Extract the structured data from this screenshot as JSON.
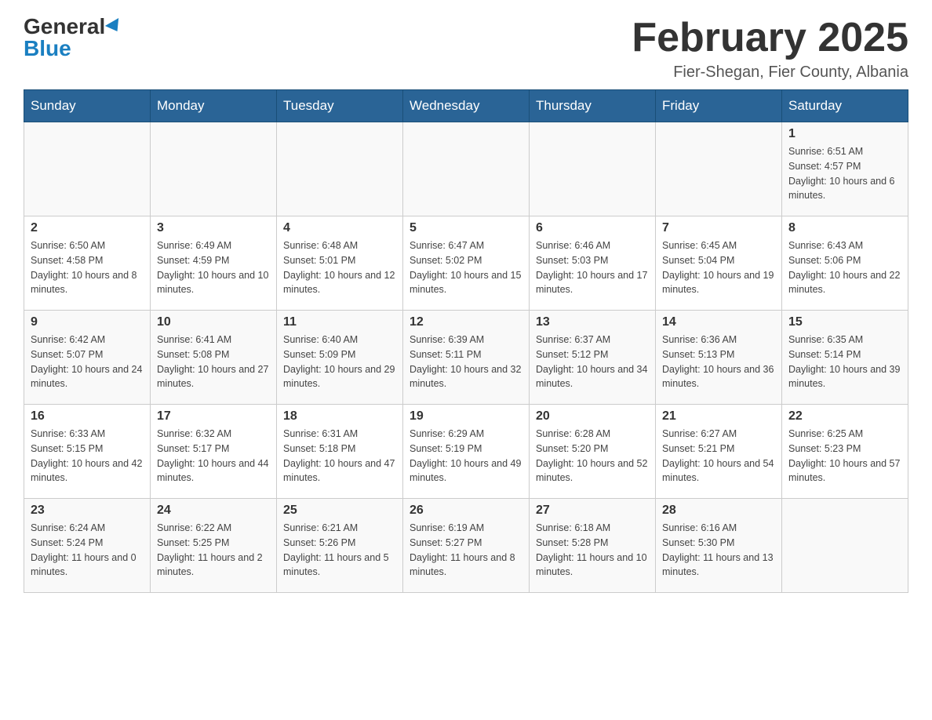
{
  "logo": {
    "general": "General",
    "blue": "Blue"
  },
  "title": "February 2025",
  "subtitle": "Fier-Shegan, Fier County, Albania",
  "days_of_week": [
    "Sunday",
    "Monday",
    "Tuesday",
    "Wednesday",
    "Thursday",
    "Friday",
    "Saturday"
  ],
  "weeks": [
    [
      {
        "day": "",
        "info": ""
      },
      {
        "day": "",
        "info": ""
      },
      {
        "day": "",
        "info": ""
      },
      {
        "day": "",
        "info": ""
      },
      {
        "day": "",
        "info": ""
      },
      {
        "day": "",
        "info": ""
      },
      {
        "day": "1",
        "info": "Sunrise: 6:51 AM\nSunset: 4:57 PM\nDaylight: 10 hours and 6 minutes."
      }
    ],
    [
      {
        "day": "2",
        "info": "Sunrise: 6:50 AM\nSunset: 4:58 PM\nDaylight: 10 hours and 8 minutes."
      },
      {
        "day": "3",
        "info": "Sunrise: 6:49 AM\nSunset: 4:59 PM\nDaylight: 10 hours and 10 minutes."
      },
      {
        "day": "4",
        "info": "Sunrise: 6:48 AM\nSunset: 5:01 PM\nDaylight: 10 hours and 12 minutes."
      },
      {
        "day": "5",
        "info": "Sunrise: 6:47 AM\nSunset: 5:02 PM\nDaylight: 10 hours and 15 minutes."
      },
      {
        "day": "6",
        "info": "Sunrise: 6:46 AM\nSunset: 5:03 PM\nDaylight: 10 hours and 17 minutes."
      },
      {
        "day": "7",
        "info": "Sunrise: 6:45 AM\nSunset: 5:04 PM\nDaylight: 10 hours and 19 minutes."
      },
      {
        "day": "8",
        "info": "Sunrise: 6:43 AM\nSunset: 5:06 PM\nDaylight: 10 hours and 22 minutes."
      }
    ],
    [
      {
        "day": "9",
        "info": "Sunrise: 6:42 AM\nSunset: 5:07 PM\nDaylight: 10 hours and 24 minutes."
      },
      {
        "day": "10",
        "info": "Sunrise: 6:41 AM\nSunset: 5:08 PM\nDaylight: 10 hours and 27 minutes."
      },
      {
        "day": "11",
        "info": "Sunrise: 6:40 AM\nSunset: 5:09 PM\nDaylight: 10 hours and 29 minutes."
      },
      {
        "day": "12",
        "info": "Sunrise: 6:39 AM\nSunset: 5:11 PM\nDaylight: 10 hours and 32 minutes."
      },
      {
        "day": "13",
        "info": "Sunrise: 6:37 AM\nSunset: 5:12 PM\nDaylight: 10 hours and 34 minutes."
      },
      {
        "day": "14",
        "info": "Sunrise: 6:36 AM\nSunset: 5:13 PM\nDaylight: 10 hours and 36 minutes."
      },
      {
        "day": "15",
        "info": "Sunrise: 6:35 AM\nSunset: 5:14 PM\nDaylight: 10 hours and 39 minutes."
      }
    ],
    [
      {
        "day": "16",
        "info": "Sunrise: 6:33 AM\nSunset: 5:15 PM\nDaylight: 10 hours and 42 minutes."
      },
      {
        "day": "17",
        "info": "Sunrise: 6:32 AM\nSunset: 5:17 PM\nDaylight: 10 hours and 44 minutes."
      },
      {
        "day": "18",
        "info": "Sunrise: 6:31 AM\nSunset: 5:18 PM\nDaylight: 10 hours and 47 minutes."
      },
      {
        "day": "19",
        "info": "Sunrise: 6:29 AM\nSunset: 5:19 PM\nDaylight: 10 hours and 49 minutes."
      },
      {
        "day": "20",
        "info": "Sunrise: 6:28 AM\nSunset: 5:20 PM\nDaylight: 10 hours and 52 minutes."
      },
      {
        "day": "21",
        "info": "Sunrise: 6:27 AM\nSunset: 5:21 PM\nDaylight: 10 hours and 54 minutes."
      },
      {
        "day": "22",
        "info": "Sunrise: 6:25 AM\nSunset: 5:23 PM\nDaylight: 10 hours and 57 minutes."
      }
    ],
    [
      {
        "day": "23",
        "info": "Sunrise: 6:24 AM\nSunset: 5:24 PM\nDaylight: 11 hours and 0 minutes."
      },
      {
        "day": "24",
        "info": "Sunrise: 6:22 AM\nSunset: 5:25 PM\nDaylight: 11 hours and 2 minutes."
      },
      {
        "day": "25",
        "info": "Sunrise: 6:21 AM\nSunset: 5:26 PM\nDaylight: 11 hours and 5 minutes."
      },
      {
        "day": "26",
        "info": "Sunrise: 6:19 AM\nSunset: 5:27 PM\nDaylight: 11 hours and 8 minutes."
      },
      {
        "day": "27",
        "info": "Sunrise: 6:18 AM\nSunset: 5:28 PM\nDaylight: 11 hours and 10 minutes."
      },
      {
        "day": "28",
        "info": "Sunrise: 6:16 AM\nSunset: 5:30 PM\nDaylight: 11 hours and 13 minutes."
      },
      {
        "day": "",
        "info": ""
      }
    ]
  ]
}
